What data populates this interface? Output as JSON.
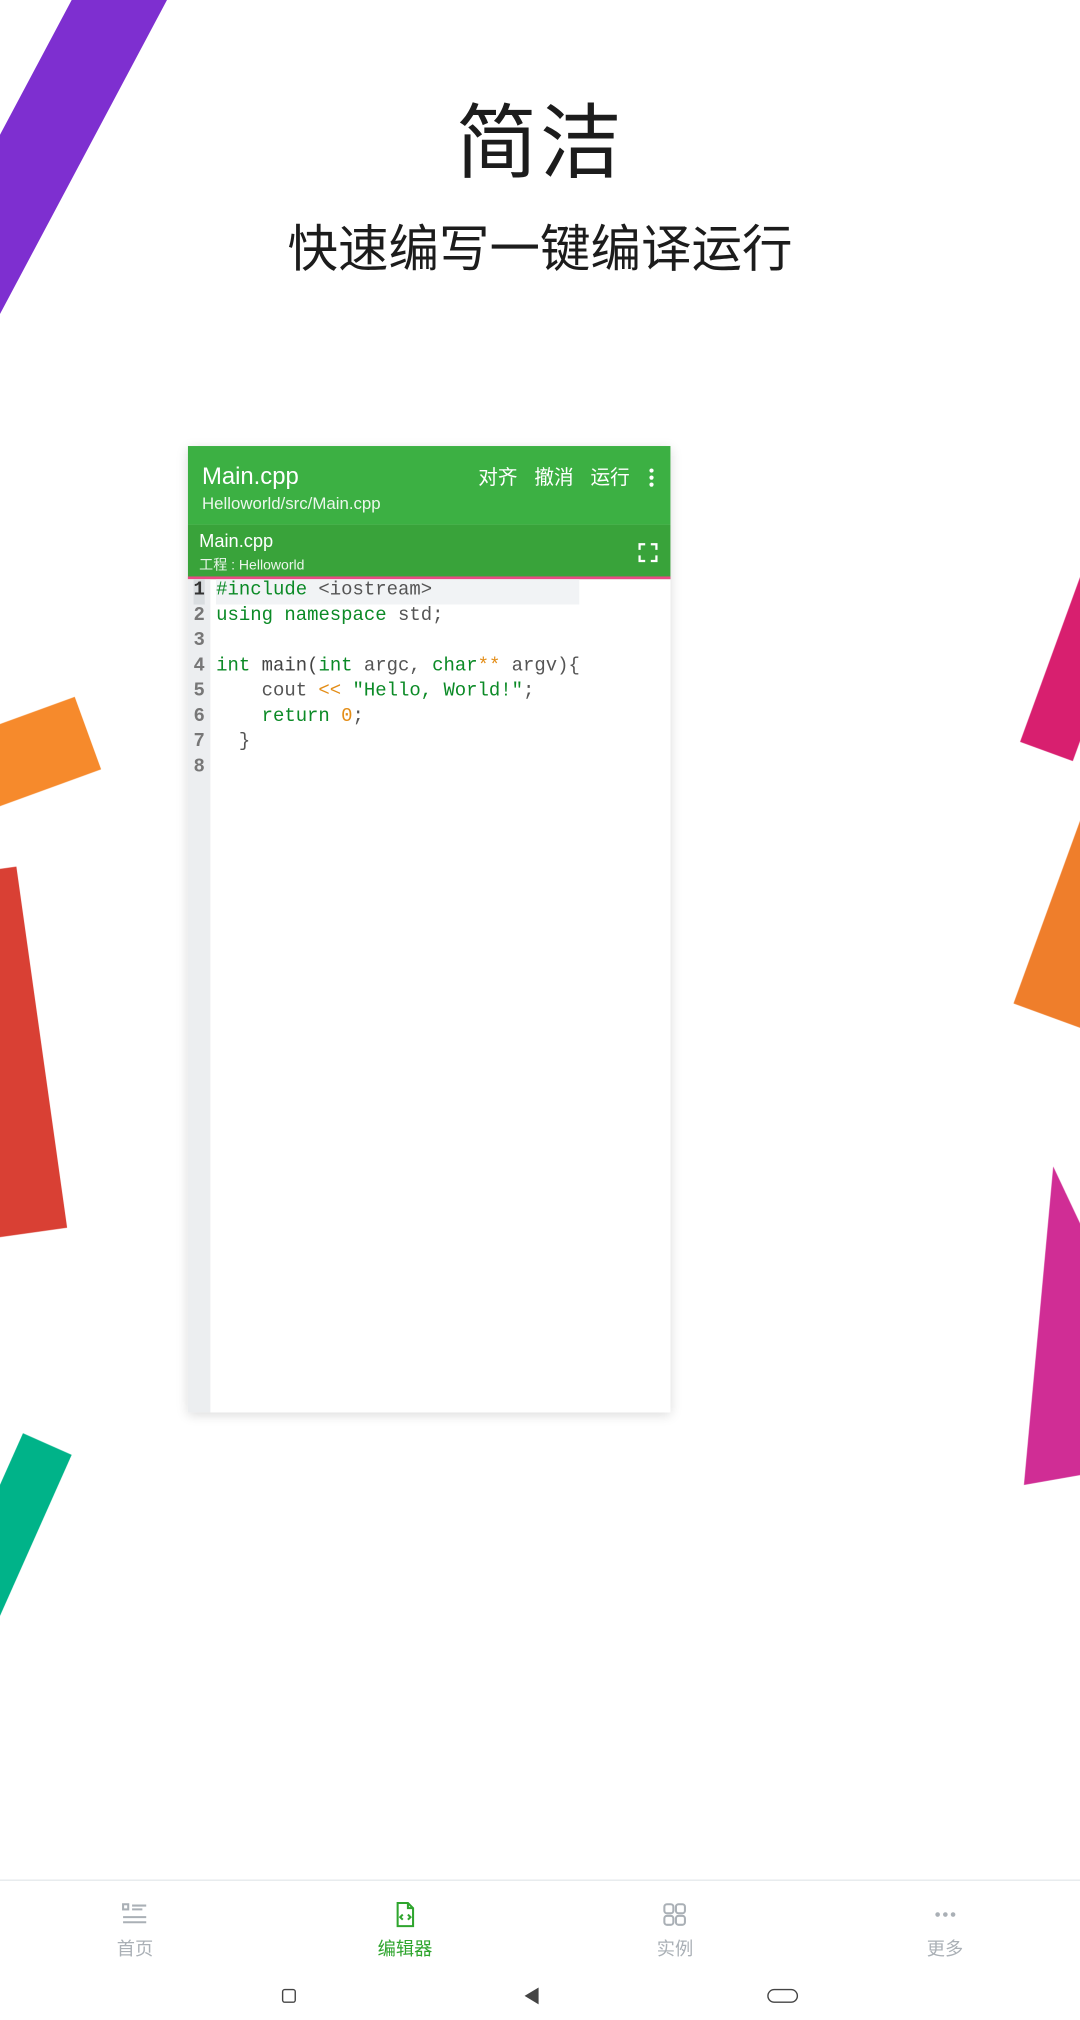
{
  "hero": {
    "title": "简洁",
    "subtitle": "快速编写一键编译运行"
  },
  "editor": {
    "filename": "Main.cpp",
    "filepath": "Helloworld/src/Main.cpp",
    "actions": {
      "align": "对齐",
      "undo": "撤消",
      "run": "运行"
    },
    "tab": {
      "label": "Main.cpp",
      "project_prefix": "工程 : ",
      "project_name": "Helloworld"
    },
    "code": {
      "l1_a": "#include",
      "l1_b": "<iostream>",
      "l2_a": "using",
      "l2_b": "namespace",
      "l2_c": "std;",
      "l4_a": "int",
      "l4_b": "main(",
      "l4_c": "int",
      "l4_d": "argc,",
      "l4_e": "char",
      "l4_f": "**",
      "l4_g": "argv){",
      "l5_a": "    cout",
      "l5_b": "<<",
      "l5_c": "\"Hello, World!\"",
      "l5_d": ";",
      "l6_a": "    ",
      "l6_b": "return",
      "l6_c": "0",
      "l6_d": ";",
      "l7": "  }"
    }
  },
  "nav": {
    "home": "首页",
    "editor": "编辑器",
    "examples": "实例",
    "more": "更多"
  }
}
